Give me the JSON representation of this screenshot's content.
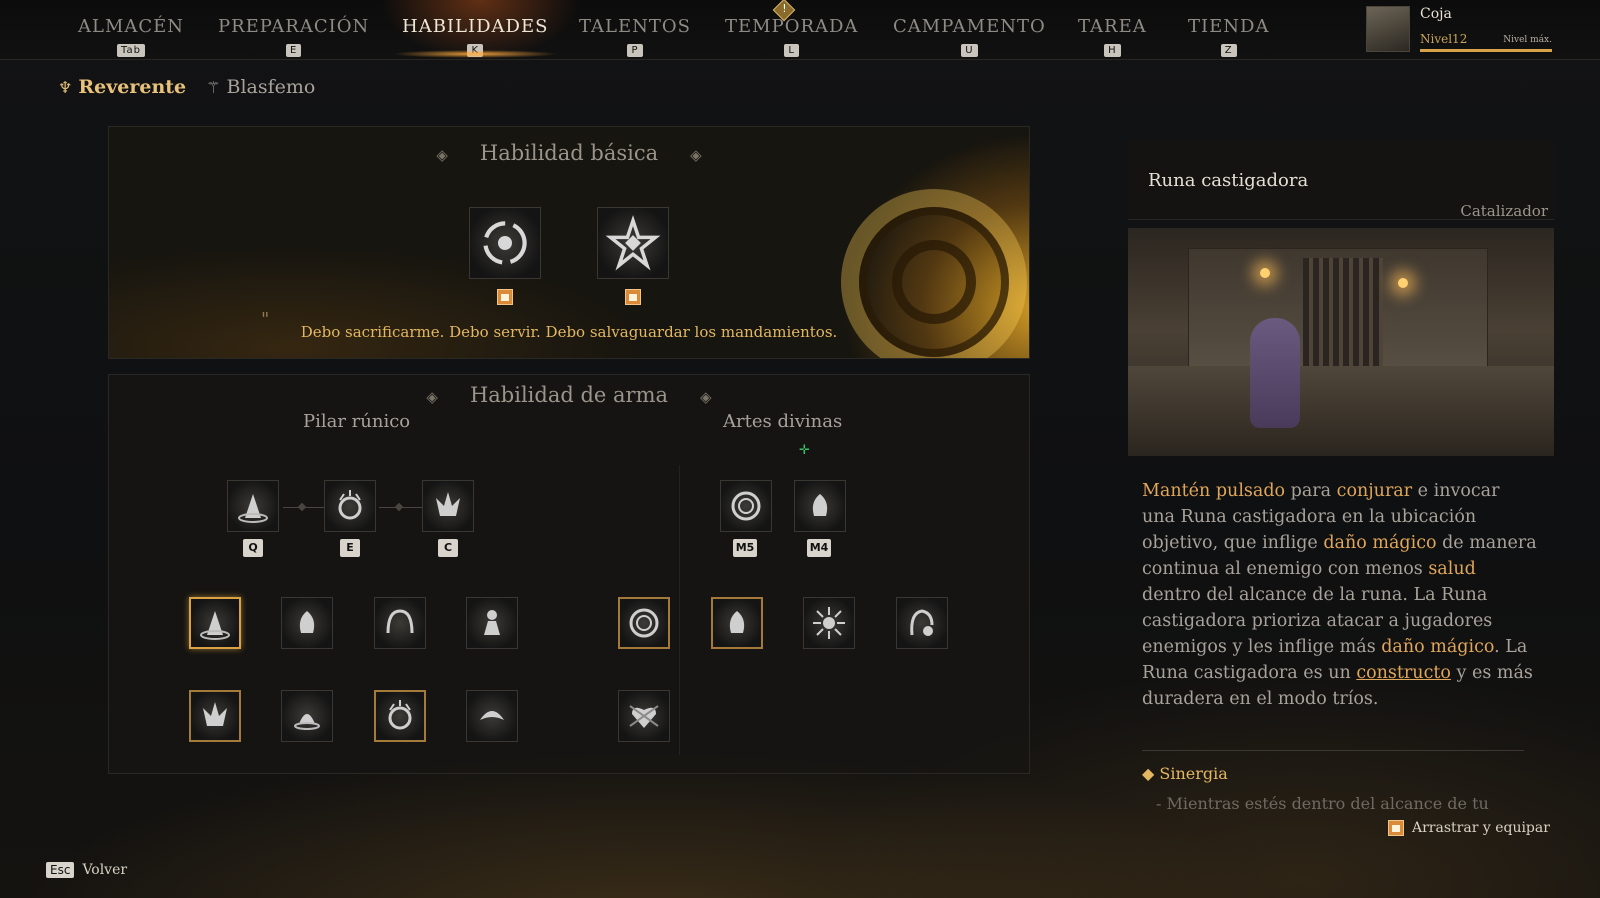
{
  "nav": {
    "items": [
      {
        "label": "ALMACÉN",
        "key": "Tab"
      },
      {
        "label": "PREPARACIÓN",
        "key": "E"
      },
      {
        "label": "HABILIDADES",
        "key": "K"
      },
      {
        "label": "TALENTOS",
        "key": "P"
      },
      {
        "label": "TEMPORADA",
        "key": "L"
      },
      {
        "label": "CAMPAMENTO",
        "key": "U"
      },
      {
        "label": "TAREA",
        "key": "H"
      },
      {
        "label": "TIENDA",
        "key": "Z"
      }
    ],
    "active": "HABILIDADES"
  },
  "player": {
    "name": "Coja",
    "level": "Nivel12",
    "level_status": "Nivel máx.",
    "level_progress": 1.0
  },
  "subtabs": [
    {
      "label": "Reverente",
      "icon": "torch-icon",
      "active": true
    },
    {
      "label": "Blasfemo",
      "icon": "wand-icon",
      "active": false
    }
  ],
  "basic": {
    "title": "Habilidad básica",
    "quote": "Debo sacrificarme. Debo servir. Debo salvaguardar los mandamientos.",
    "quote_mark": "\""
  },
  "weapon": {
    "title": "Habilidad de arma",
    "left_title": "Pilar rúnico",
    "right_title": "Artes divinas",
    "left_keys": [
      "Q",
      "E",
      "C"
    ],
    "right_keys": [
      "M5",
      "M4"
    ]
  },
  "detail": {
    "title": "Runa castigadora",
    "type": "Catalizador",
    "desc": {
      "p1": "Mantén pulsado",
      "p2": " para ",
      "p3": "conjurar",
      "p4": " e invocar una Runa castigadora en la ubicación objetivo, que inflige ",
      "p5": "daño mágico",
      "p6": " de manera continua al enemigo con menos ",
      "p7": "salud",
      "p8": " dentro del alcance de la runa. La Runa castigadora prioriza atacar a jugadores enemigos y les inflige más ",
      "p9": "daño mágico",
      "p10": ". La Runa castigadora es un ",
      "p11": "constructo",
      "p12": " y es más duradera en el modo tríos."
    },
    "synergy_label": "Sinergia",
    "synergy_text": "Mientras estés dentro del alcance de tu"
  },
  "footer": {
    "drag_equip": "Arrastrar y equipar",
    "back_key": "Esc",
    "back_label": "Volver"
  },
  "colors": {
    "accent": "#e3b761",
    "highlight": "#e0a65a",
    "selected_border": "#d9a245"
  }
}
